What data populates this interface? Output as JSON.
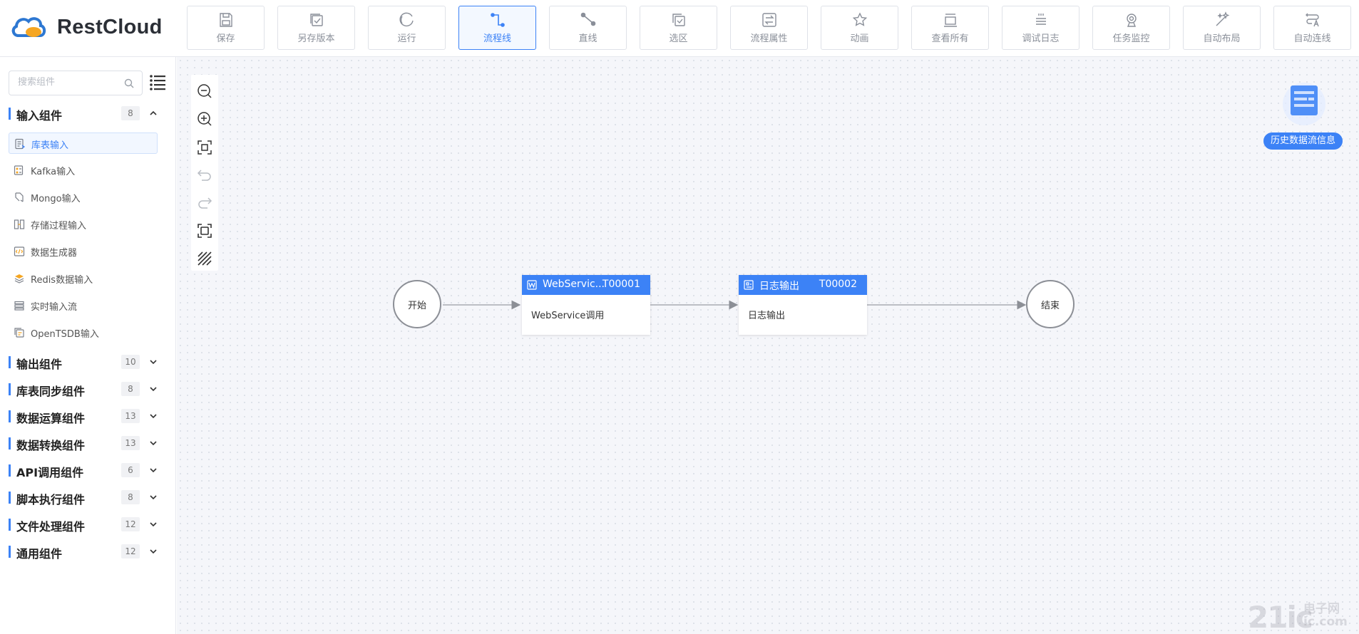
{
  "brand": {
    "name": "RestCloud"
  },
  "toolbar": [
    {
      "label": "保存",
      "icon": "save-icon"
    },
    {
      "label": "另存版本",
      "icon": "save-version-icon"
    },
    {
      "label": "运行",
      "icon": "run-icon"
    },
    {
      "label": "流程线",
      "icon": "flow-line-icon",
      "active": true
    },
    {
      "label": "直线",
      "icon": "straight-line-icon"
    },
    {
      "label": "选区",
      "icon": "select-area-icon"
    },
    {
      "label": "流程属性",
      "icon": "flow-properties-icon"
    },
    {
      "label": "动画",
      "icon": "animation-icon"
    },
    {
      "label": "查看所有",
      "icon": "view-all-icon"
    },
    {
      "label": "调试日志",
      "icon": "debug-log-icon"
    },
    {
      "label": "任务监控",
      "icon": "task-monitor-icon"
    },
    {
      "label": "自动布局",
      "icon": "auto-layout-icon"
    },
    {
      "label": "自动连线",
      "icon": "auto-connect-icon"
    }
  ],
  "sidebar": {
    "search_placeholder": "搜索组件",
    "input_group": {
      "title": "输入组件",
      "count": "8",
      "expanded": true
    },
    "input_items": [
      {
        "label": "库表输入",
        "active": true
      },
      {
        "label": "Kafka输入"
      },
      {
        "label": "Mongo输入"
      },
      {
        "label": "存储过程输入"
      },
      {
        "label": "数据生成器"
      },
      {
        "label": "Redis数据输入"
      },
      {
        "label": "实时输入流"
      },
      {
        "label": "OpenTSDB输入"
      }
    ],
    "groups": [
      {
        "title": "输出组件",
        "count": "10"
      },
      {
        "title": "库表同步组件",
        "count": "8"
      },
      {
        "title": "数据运算组件",
        "count": "13"
      },
      {
        "title": "数据转换组件",
        "count": "13"
      },
      {
        "title": "API调用组件",
        "count": "6"
      },
      {
        "title": "脚本执行组件",
        "count": "8"
      },
      {
        "title": "文件处理组件",
        "count": "12"
      },
      {
        "title": "通用组件",
        "count": "12"
      }
    ]
  },
  "canvas": {
    "history_label": "历史数据流信息",
    "start_label": "开始",
    "end_label": "结束",
    "task1": {
      "name": "WebServic...",
      "id": "T00001",
      "body": "WebService调用"
    },
    "task2": {
      "name": "日志输出",
      "id": "T00002",
      "body": "日志输出"
    }
  },
  "watermark": {
    "main": "21ic",
    "sub1": "电子网",
    "sub2": "ic.com"
  },
  "colors": {
    "accent": "#3c82f6",
    "border": "#dfe2e8"
  }
}
